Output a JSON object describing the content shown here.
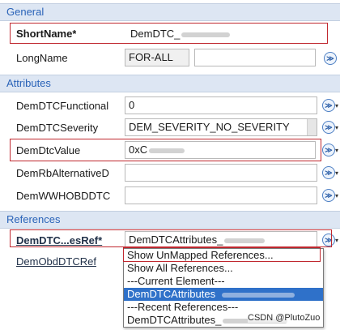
{
  "sections": {
    "general": "General",
    "attributes": "Attributes",
    "references": "References"
  },
  "general": {
    "short_name_label": "ShortName*",
    "short_name_value": "DemDTC_",
    "long_name_label": "LongName",
    "long_name_lang": "FOR-ALL",
    "long_name_value": ""
  },
  "attributes": {
    "functional_label": "DemDTCFunctional",
    "functional_value": "0",
    "severity_label": "DemDTCSeverity",
    "severity_value": "DEM_SEVERITY_NO_SEVERITY",
    "dtc_value_label": "DemDtcValue",
    "dtc_value_value": "0xC",
    "rb_alt_label": "DemRbAlternativeD",
    "rb_alt_value": "",
    "wwhobd_label": "DemWWHOBDDTC",
    "wwhobd_value": ""
  },
  "references": {
    "attr_ref_label": "DemDTC...esRef*",
    "attr_ref_value": "DemDTCAttributes_",
    "obd_ref_label": "DemObdDTCRef",
    "obd_ref_value": ""
  },
  "dropdown": {
    "items": [
      "Show UnMapped References...",
      "Show All References...",
      "---Current Element---",
      "DemDTCAttributes",
      "---Recent References---",
      "DemDTCAttributes_"
    ]
  },
  "watermark": "CSDN @PlutoZuo",
  "colors": {
    "section_header_bg": "#dde6f3",
    "section_header_text": "#2a63b8",
    "highlight_border": "#c0282f",
    "selected_item": "#2f71c9"
  }
}
